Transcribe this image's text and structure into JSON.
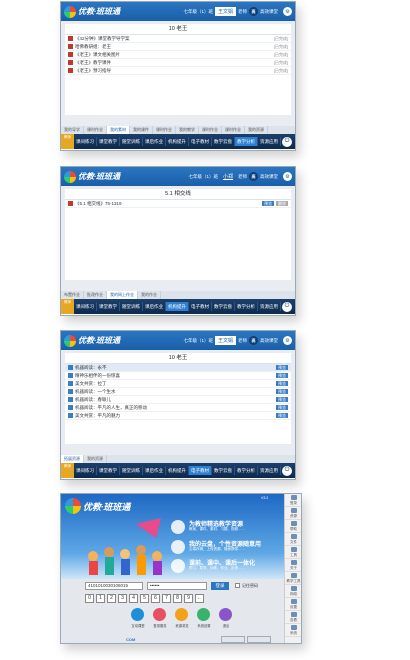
{
  "app": {
    "logo": "优教·班班通",
    "grade": "七年级（1）班",
    "greeting": "老师",
    "mode": "高效课堂",
    "badge": "高",
    "role": "教师"
  },
  "p1": {
    "user": "王文娟",
    "title": "10 老王",
    "items": [
      {
        "t": "《42分钟》课堂教学导学案",
        "r": "[已完成]"
      },
      {
        "t": "哈佛教研组：老王",
        "r": "[已完成]"
      },
      {
        "t": "《老王》课文相关图片",
        "r": "[已完成]"
      },
      {
        "t": "《老王》教学课件",
        "r": "[已完成]"
      },
      {
        "t": "《老王》预习指导",
        "r": "[已完成]"
      }
    ],
    "tabs": [
      "我的导学",
      "课时作业",
      "我的素材",
      "我的课件",
      "课时作业",
      "我的教学",
      "课时作业",
      "课时作业",
      "我的资源"
    ],
    "nav": [
      "课间练习",
      "课堂教学",
      "随堂训练",
      "课后作业",
      "机构提升",
      "电子教材",
      "数学云盘",
      "教学分析",
      "资源应用"
    ]
  },
  "p2": {
    "user": "小郑",
    "title": "5.1 相交线",
    "items": [
      {
        "t": "《5.1 相交线》75-1319",
        "b": "预览",
        "b2": "删除"
      }
    ],
    "tabs": [
      "布置作业",
      "批改作业",
      "我的网上作业",
      "我的作业"
    ],
    "nav": [
      "课间练习",
      "课堂教学",
      "随堂训练",
      "课后作业",
      "机构提升",
      "电子教材",
      "数学云盘",
      "教学分析",
      "资源应用"
    ]
  },
  "p3": {
    "user": "王文娟",
    "title": "10 老王",
    "items": [
      {
        "t": "机器阅读：永不"
      },
      {
        "t": "精神乐相伴的一份惊喜"
      },
      {
        "t": "美文共赏：拉丁"
      },
      {
        "t": "机器阅读：一个生水"
      },
      {
        "t": "机器阅读：春联儿"
      },
      {
        "t": "机器阅读：平凡的人生，真正的移动"
      },
      {
        "t": "美文共赏：平凡的魅力"
      }
    ],
    "btn": "预览",
    "tabs": [
      "拓展资源",
      "我的资源"
    ],
    "nav": [
      "课间练习",
      "课堂教学",
      "随堂训练",
      "课后作业",
      "机构提升",
      "电子教材",
      "数学云盘",
      "教学分析",
      "资源应用"
    ]
  },
  "login": {
    "logo": "优教·班班通",
    "version": "V3.2",
    "s1": "为教师精选教学资源",
    "s1sub": "教案、课件、素材、习题、视频……",
    "s2": "我的云盘，个性资源随意用",
    "s2sub": "云端存储，上传资源，随身携带……",
    "s3": "课前、课中、课后一体化",
    "s3sub": "预习、导学、训练、作业、反馈……",
    "account": "4101010030106015",
    "password": "••••••",
    "login_btn": "登录",
    "remember": "记住密码",
    "keys": [
      "0",
      "1",
      "2",
      "3",
      "4",
      "5",
      "6",
      "7",
      "8",
      "9",
      "←"
    ],
    "tools": [
      "互动课堂",
      "登录服务",
      "资源浏览",
      "系统设置",
      "退出"
    ],
    "footer": "COM",
    "side": [
      "登录",
      "资源",
      "帮助",
      "文件",
      "工具",
      "关于",
      "教学工具",
      "网络",
      "设置",
      "查看",
      "系统",
      "退出"
    ]
  }
}
